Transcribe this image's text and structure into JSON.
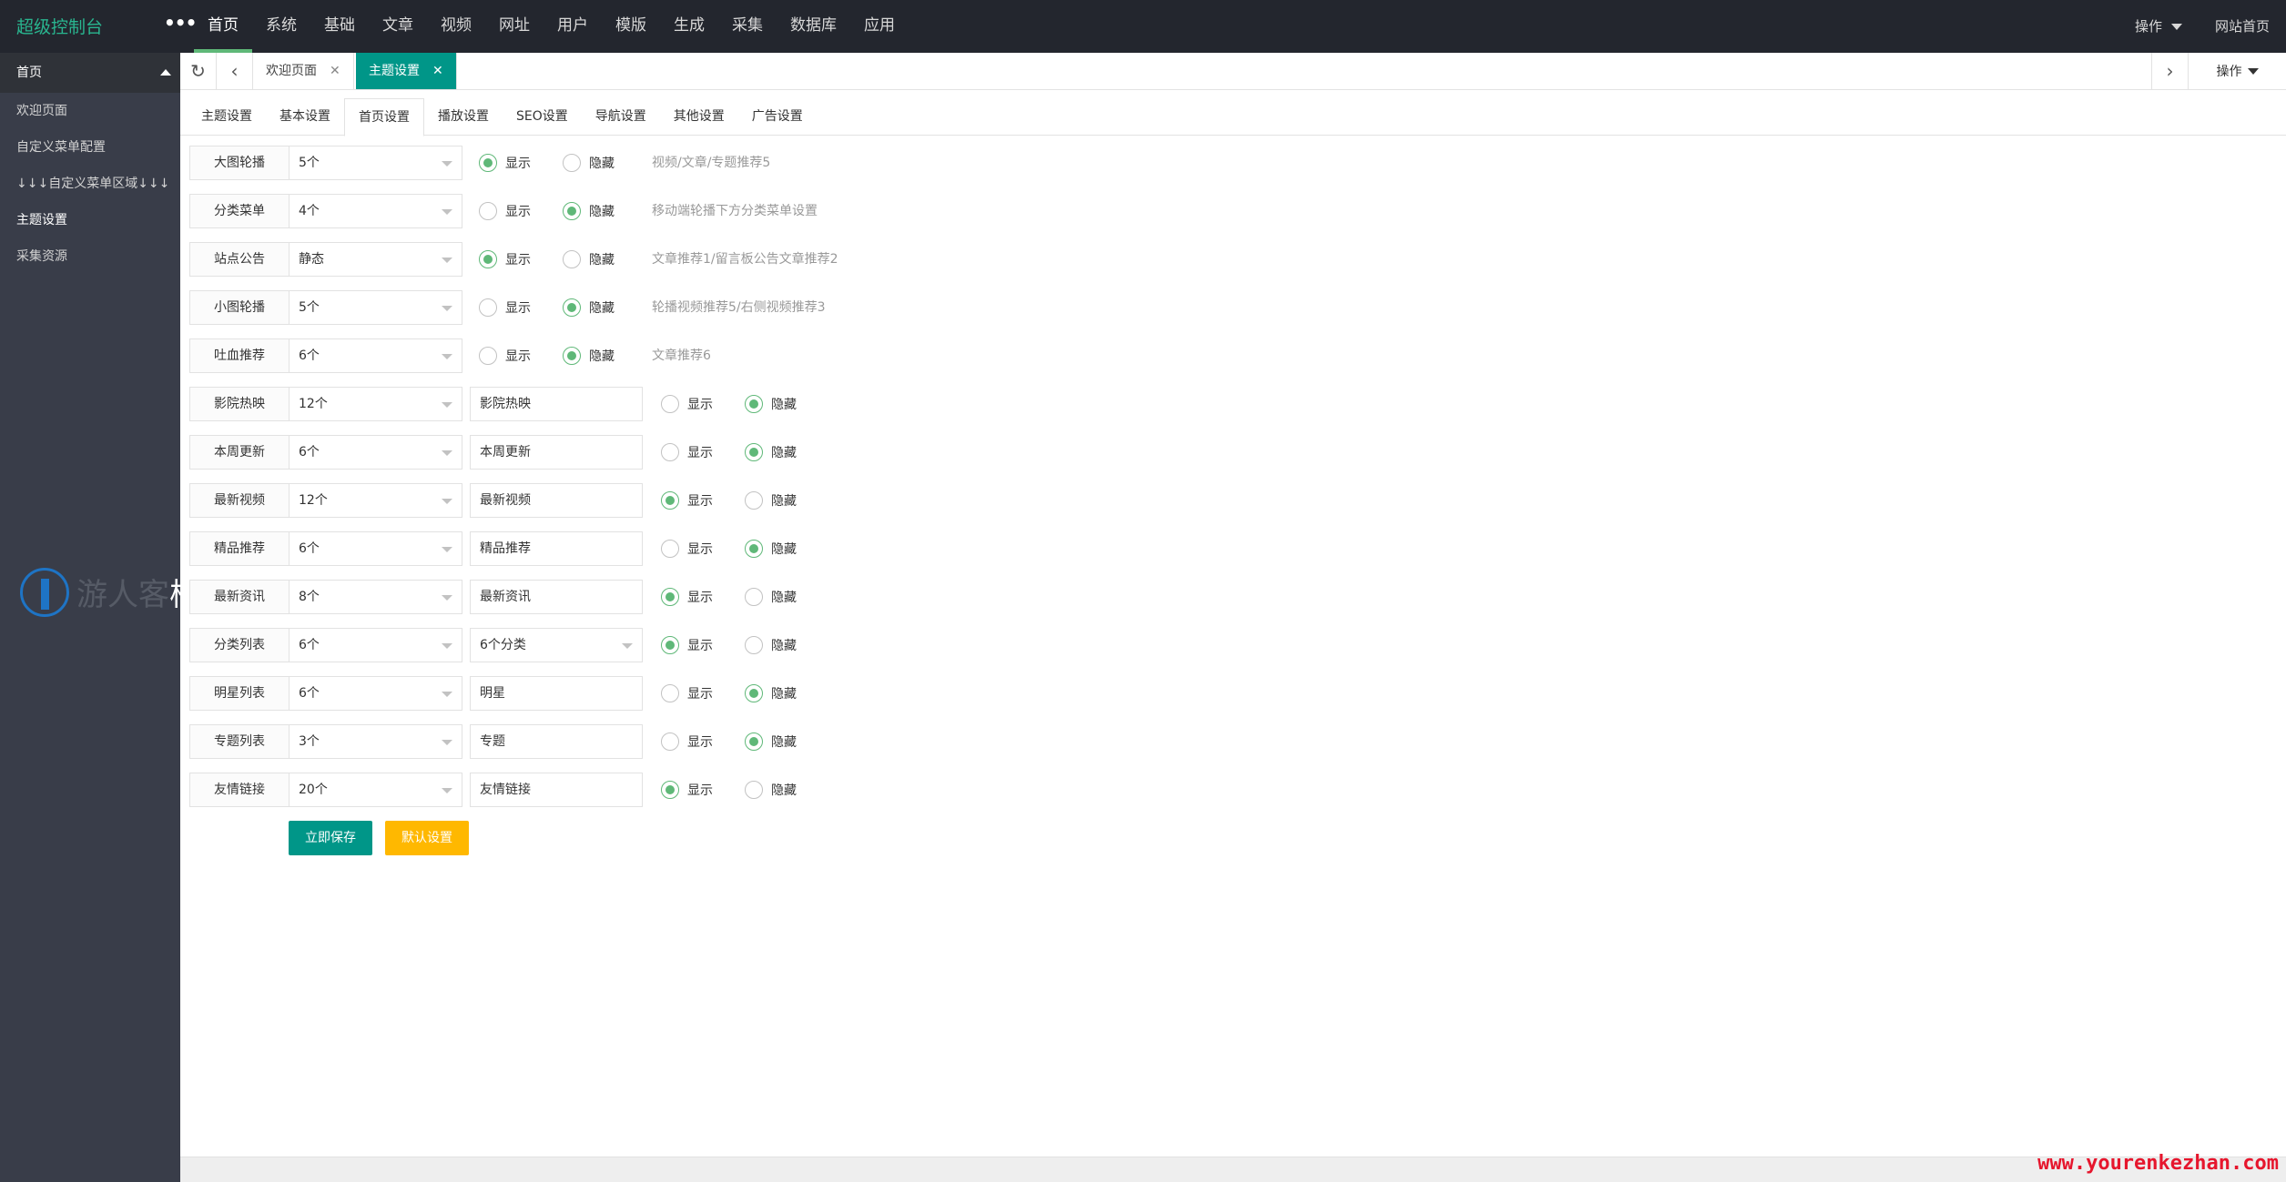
{
  "header": {
    "brand": "超级控制台",
    "more": "•••",
    "nav": [
      "首页",
      "系统",
      "基础",
      "文章",
      "视频",
      "网址",
      "用户",
      "模版",
      "生成",
      "采集",
      "数据库",
      "应用"
    ],
    "right": {
      "op": "操作",
      "home": "网站首页"
    }
  },
  "sidebar": {
    "head": "首页",
    "items": [
      "欢迎页面",
      "自定义菜单配置",
      "↓↓↓自定义菜单区域↓↓↓",
      "主题设置",
      "采集资源"
    ]
  },
  "watermark": {
    "text_main": "游人客",
    "text_end": "栈"
  },
  "tabstrip": {
    "tabs": [
      {
        "label": "欢迎页面",
        "close": "✕"
      },
      {
        "label": "主题设置",
        "close": "✕"
      }
    ],
    "op": "操作"
  },
  "subtabs": [
    "主题设置",
    "基本设置",
    "首页设置",
    "播放设置",
    "SEO设置",
    "导航设置",
    "其他设置",
    "广告设置"
  ],
  "radio_labels": {
    "show": "显示",
    "hide": "隐藏"
  },
  "rows": [
    {
      "label": "大图轮播",
      "count": "5个",
      "show": true,
      "hint": "视频/文章/专题推荐5"
    },
    {
      "label": "分类菜单",
      "count": "4个",
      "show": false,
      "hint": "移动端轮播下方分类菜单设置"
    },
    {
      "label": "站点公告",
      "count": "静态",
      "show": true,
      "hint": "文章推荐1/留言板公告文章推荐2"
    },
    {
      "label": "小图轮播",
      "count": "5个",
      "show": false,
      "hint": "轮播视频推荐5/右侧视频推荐3"
    },
    {
      "label": "吐血推荐",
      "count": "6个",
      "show": false,
      "hint": "文章推荐6"
    },
    {
      "label": "影院热映",
      "count": "12个",
      "title": "影院热映",
      "show": false
    },
    {
      "label": "本周更新",
      "count": "6个",
      "title": "本周更新",
      "show": false
    },
    {
      "label": "最新视频",
      "count": "12个",
      "title": "最新视频",
      "show": true
    },
    {
      "label": "精品推荐",
      "count": "6个",
      "title": "精品推荐",
      "show": false
    },
    {
      "label": "最新资讯",
      "count": "8个",
      "title": "最新资讯",
      "show": true
    },
    {
      "label": "分类列表",
      "count": "6个",
      "select2": "6个分类",
      "show": true
    },
    {
      "label": "明星列表",
      "count": "6个",
      "title": "明星",
      "show": false
    },
    {
      "label": "专题列表",
      "count": "3个",
      "title": "专题",
      "show": false
    },
    {
      "label": "友情链接",
      "count": "20个",
      "title": "友情链接",
      "show": true
    }
  ],
  "buttons": {
    "save": "立即保存",
    "default": "默认设置"
  },
  "footer": {
    "watermark": "www.yourenkezhan.com"
  },
  "colors": {
    "accent": "#009688",
    "radio": "#5fb878",
    "warn": "#ffb800",
    "header": "#23262e",
    "sidebar": "#393d49"
  }
}
